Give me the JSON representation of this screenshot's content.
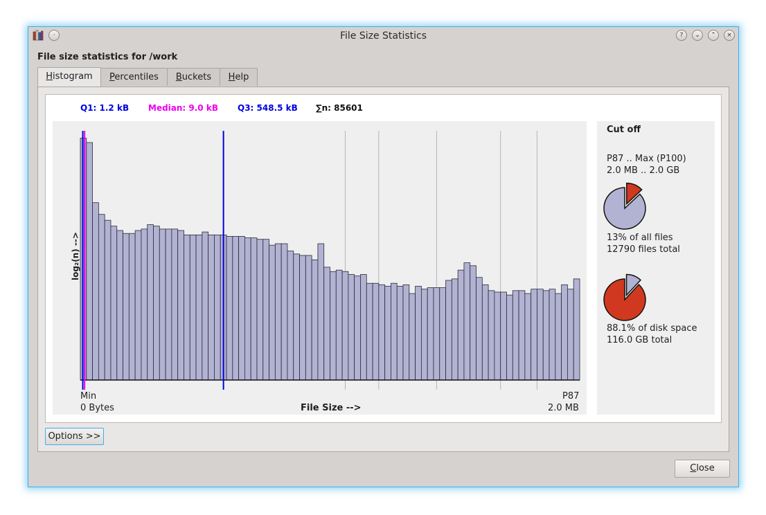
{
  "window": {
    "title": "File Size Statistics"
  },
  "heading": "File size statistics for /work",
  "tabs": [
    {
      "label": "Histogram",
      "underline": "H",
      "rest": "istogram",
      "active": true
    },
    {
      "label": "Percentiles",
      "underline": "P",
      "rest": "ercentiles",
      "active": false
    },
    {
      "label": "Buckets",
      "underline": "B",
      "rest": "uckets",
      "active": false
    },
    {
      "label": "Help",
      "underline": "H",
      "rest": "elp",
      "active": false
    }
  ],
  "stats": {
    "q1": "Q1: 1.2 kB",
    "median": "Median: 9.0 kB",
    "q3": "Q3: 548.5 kB",
    "n": "∑n: 85601"
  },
  "colors": {
    "q1": "#0000e0",
    "median": "#ee00ee",
    "q3": "#0000e0",
    "bars": "#b2b2d2",
    "pie_highlight": "#d0391f"
  },
  "chart_data": {
    "type": "bar",
    "title": "",
    "xlabel": "File Size  -->",
    "ylabel": "log₂(n) -->",
    "x_min_label": "Min",
    "x_min_value": "0 Bytes",
    "x_max_label": "P87",
    "x_max_value": "2.0 MB",
    "y_scale": "log2",
    "ylim": [
      0,
      17
    ],
    "values": [
      16.5,
      16.2,
      12.1,
      11.3,
      10.9,
      10.5,
      10.2,
      10.0,
      10.0,
      10.2,
      10.3,
      10.6,
      10.5,
      10.3,
      10.3,
      10.3,
      10.2,
      9.9,
      9.9,
      9.9,
      10.1,
      9.9,
      9.9,
      9.9,
      9.8,
      9.8,
      9.8,
      9.7,
      9.7,
      9.6,
      9.6,
      9.2,
      9.3,
      9.3,
      8.8,
      8.6,
      8.5,
      8.5,
      8.2,
      9.3,
      7.7,
      7.4,
      7.5,
      7.4,
      7.2,
      7.1,
      7.2,
      6.6,
      6.6,
      6.5,
      6.4,
      6.6,
      6.4,
      6.5,
      5.9,
      6.4,
      6.2,
      6.3,
      6.3,
      6.3,
      6.8,
      6.9,
      7.5,
      8.0,
      7.8,
      7.0,
      6.5,
      6.1,
      6.0,
      6.0,
      5.8,
      6.1,
      6.1,
      5.9,
      6.2,
      6.2,
      6.1,
      6.2,
      5.9,
      6.5,
      6.2,
      6.9
    ],
    "markers": [
      {
        "name": "Q1",
        "bin": 0.4,
        "color": "#0000e0"
      },
      {
        "name": "Median",
        "bin": 0.7,
        "color": "#ee00ee"
      },
      {
        "name": "Q3",
        "bin": 23.5,
        "color": "#0000e0"
      }
    ],
    "gridlines_at_bins": [
      43.5,
      49,
      58.5,
      69,
      75
    ]
  },
  "cutoff": {
    "title": "Cut off",
    "range_label": "P87 .. Max (P100)",
    "range_value": "2.0 MB .. 2.0 GB",
    "files_pct_text": "13% of all files",
    "files_total_text": "12790 files total",
    "files_fraction": 0.13,
    "disk_pct_text": "88.1% of disk space",
    "disk_total_text": "116.0 GB total",
    "disk_fraction": 0.881
  },
  "buttons": {
    "options": "Options >>",
    "close_underline": "C",
    "close_rest": "lose"
  }
}
